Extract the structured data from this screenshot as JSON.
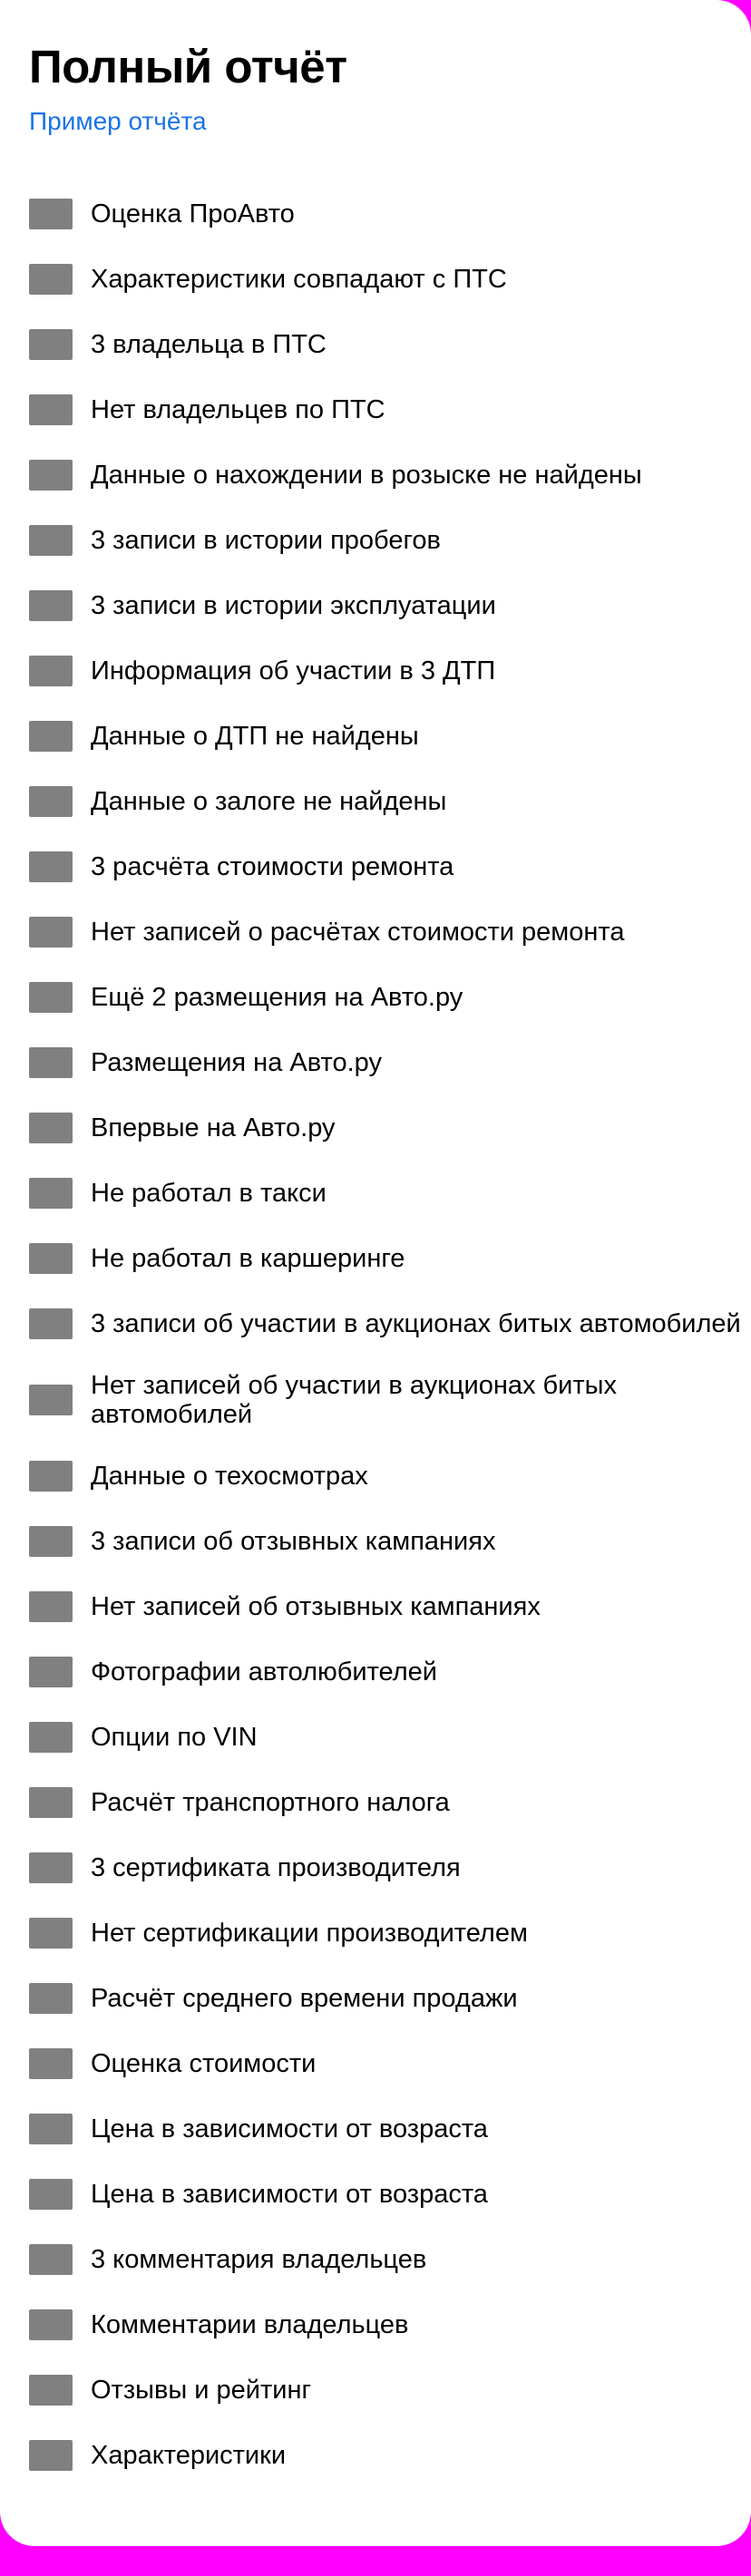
{
  "report": {
    "title": "Полный отчёт",
    "sample_link": "Пример отчёта",
    "icon_color": "#808080",
    "link_color": "#1a73e8",
    "background_color": "#ff00ff",
    "items": [
      {
        "label": "Оценка ПроАвто",
        "icon": "placeholder-icon"
      },
      {
        "label": "Характеристики совпадают с ПТС",
        "icon": "placeholder-icon"
      },
      {
        "label": "3 владельца в ПТС",
        "icon": "placeholder-icon"
      },
      {
        "label": "Нет владельцев по ПТС",
        "icon": "placeholder-icon"
      },
      {
        "label": "Данные о нахождении в розыске не найдены",
        "icon": "placeholder-icon"
      },
      {
        "label": "3 записи в истории пробегов",
        "icon": "placeholder-icon"
      },
      {
        "label": "3 записи в истории эксплуатации",
        "icon": "placeholder-icon"
      },
      {
        "label": "Информация об участии в 3 ДТП",
        "icon": "placeholder-icon"
      },
      {
        "label": "Данные о ДТП не найдены",
        "icon": "placeholder-icon"
      },
      {
        "label": "Данные о залоге не найдены",
        "icon": "placeholder-icon"
      },
      {
        "label": "3 расчёта стоимости ремонта",
        "icon": "placeholder-icon"
      },
      {
        "label": "Нет записей о расчётах стоимости ремонта",
        "icon": "placeholder-icon"
      },
      {
        "label": "Ещё 2 размещения на Авто.ру",
        "icon": "placeholder-icon"
      },
      {
        "label": "Размещения на Авто.ру",
        "icon": "placeholder-icon"
      },
      {
        "label": "Впервые на Авто.ру",
        "icon": "placeholder-icon"
      },
      {
        "label": "Не работал в такси",
        "icon": "placeholder-icon"
      },
      {
        "label": "Не работал в каршеринге",
        "icon": "placeholder-icon"
      },
      {
        "label": "3 записи об участии в аукционах битых автомобилей",
        "icon": "placeholder-icon"
      },
      {
        "label": "Нет записей об участии в аукционах битых автомобилей",
        "icon": "placeholder-icon",
        "wrap": true
      },
      {
        "label": "Данные о техосмотрах",
        "icon": "placeholder-icon"
      },
      {
        "label": "3 записи об отзывных кампаниях",
        "icon": "placeholder-icon"
      },
      {
        "label": "Нет записей об отзывных кампаниях",
        "icon": "placeholder-icon"
      },
      {
        "label": "Фотографии автолюбителей",
        "icon": "placeholder-icon"
      },
      {
        "label": "Опции по VIN",
        "icon": "placeholder-icon"
      },
      {
        "label": "Расчёт транспортного налога",
        "icon": "placeholder-icon"
      },
      {
        "label": "3 сертификата производителя",
        "icon": "placeholder-icon"
      },
      {
        "label": "Нет сертификации производителем",
        "icon": "placeholder-icon"
      },
      {
        "label": "Расчёт среднего времени продажи",
        "icon": "placeholder-icon"
      },
      {
        "label": "Оценка стоимости",
        "icon": "placeholder-icon"
      },
      {
        "label": "Цена в зависимости от возраста",
        "icon": "placeholder-icon"
      },
      {
        "label": "Цена в зависимости от возраста",
        "icon": "placeholder-icon"
      },
      {
        "label": "3 комментария владельцев",
        "icon": "placeholder-icon"
      },
      {
        "label": "Комментарии владельцев",
        "icon": "placeholder-icon"
      },
      {
        "label": "Отзывы и рейтинг",
        "icon": "placeholder-icon"
      },
      {
        "label": "Характеристики",
        "icon": "placeholder-icon"
      }
    ]
  }
}
